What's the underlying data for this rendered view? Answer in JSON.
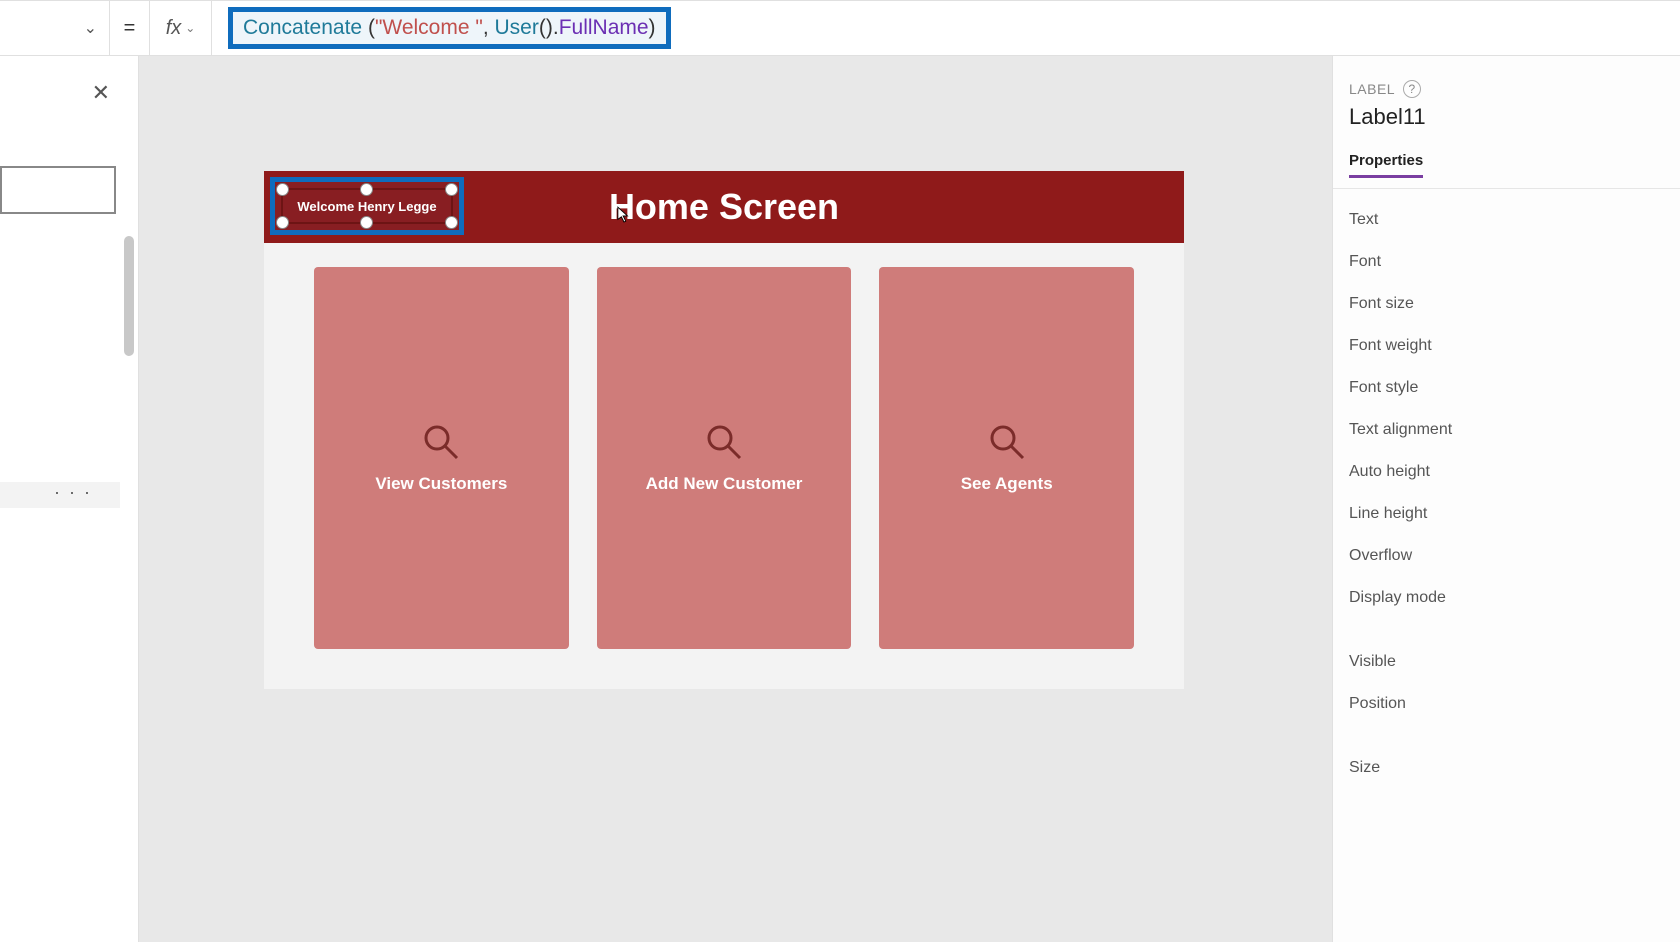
{
  "formula_bar": {
    "property_dropdown_icon": "⌄",
    "equals": "=",
    "fx_label": "fx",
    "tokens": {
      "fn": "Concatenate",
      "space": " ",
      "open": "(",
      "str": "\"Welcome \"",
      "comma": ", ",
      "fn2": "User",
      "open2": "(",
      "close2": ")",
      "dot": ".",
      "prop": "FullName",
      "close": ")"
    }
  },
  "left_panel": {
    "ellipsis": "· · ·"
  },
  "canvas": {
    "header_title": "Home Screen",
    "welcome_label": "Welcome Henry Legge",
    "cards": [
      {
        "label": "View Customers"
      },
      {
        "label": "Add New Customer"
      },
      {
        "label": "See Agents"
      }
    ]
  },
  "right_panel": {
    "type_label": "LABEL",
    "control_name": "Label11",
    "tab": "Properties",
    "props": [
      "Text",
      "Font",
      "Font size",
      "Font weight",
      "Font style",
      "Text alignment",
      "Auto height",
      "Line height",
      "Overflow",
      "Display mode"
    ],
    "props2": [
      "Visible",
      "Position"
    ],
    "props3": [
      "Size"
    ]
  }
}
